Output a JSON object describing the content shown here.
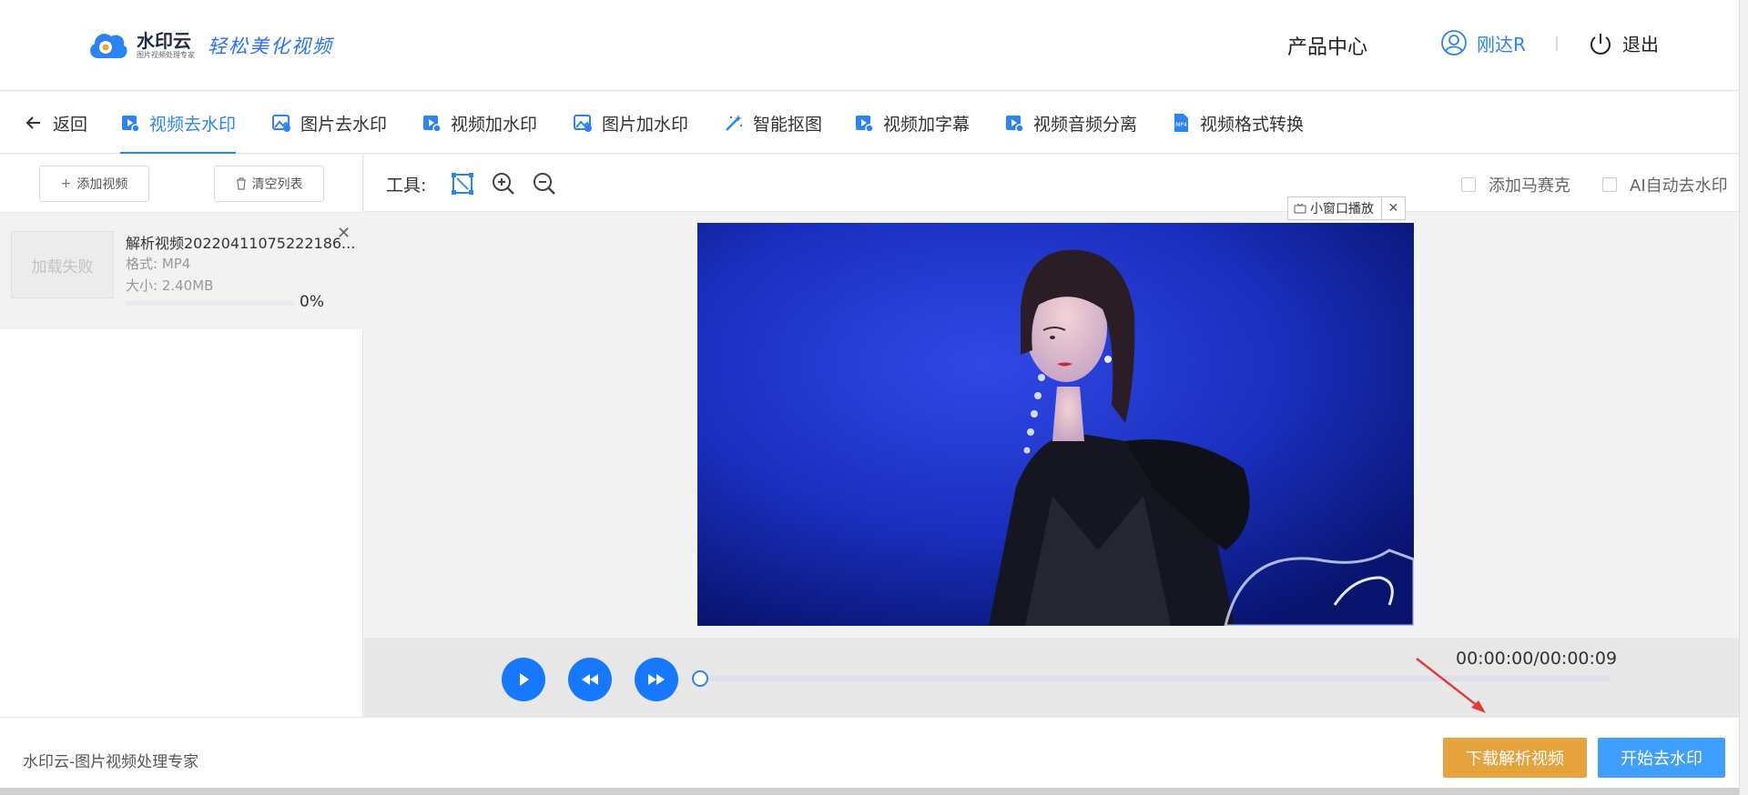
{
  "header": {
    "logo_title": "水印云",
    "logo_subtitle": "图片视频处理专家",
    "slogan": "轻松美化视频",
    "product_center": "产品中心",
    "username": "刚达R",
    "logout": "退出"
  },
  "tabs": {
    "back": "返回",
    "items": [
      {
        "label": "视频去水印",
        "icon": "video-icon"
      },
      {
        "label": "图片去水印",
        "icon": "image-icon"
      },
      {
        "label": "视频加水印",
        "icon": "video-icon"
      },
      {
        "label": "图片加水印",
        "icon": "image-icon"
      },
      {
        "label": "智能抠图",
        "icon": "magic-wand-icon"
      },
      {
        "label": "视频加字幕",
        "icon": "video-icon"
      },
      {
        "label": "视频音频分离",
        "icon": "video-icon"
      },
      {
        "label": "视频格式转换",
        "icon": "mp4-file-icon"
      }
    ],
    "active_index": 0
  },
  "left_panel": {
    "add_video": "添加视频",
    "clear_list": "清空列表",
    "file": {
      "thumbnail_text": "加载失败",
      "name": "解析视频20220411075222186...",
      "format": "格式:  MP4",
      "size": "大小:  2.40MB",
      "progress_fraction": 0,
      "progress_text": "0%"
    }
  },
  "toolbar": {
    "label": "工具:",
    "mosaic": "添加马赛克",
    "ai_remove": "AI自动去水印"
  },
  "stage": {
    "mini_window": "小窗口播放"
  },
  "player": {
    "time": "00:00:00/00:00:09",
    "progress_fraction": 0
  },
  "footer": {
    "brand": "水印云-图片视频处理专家",
    "download_button": "下载解析视频",
    "start_button": "开始去水印"
  },
  "colors": {
    "accent": "#2b84f6",
    "download": "#e6a23c",
    "start": "#409eff"
  }
}
